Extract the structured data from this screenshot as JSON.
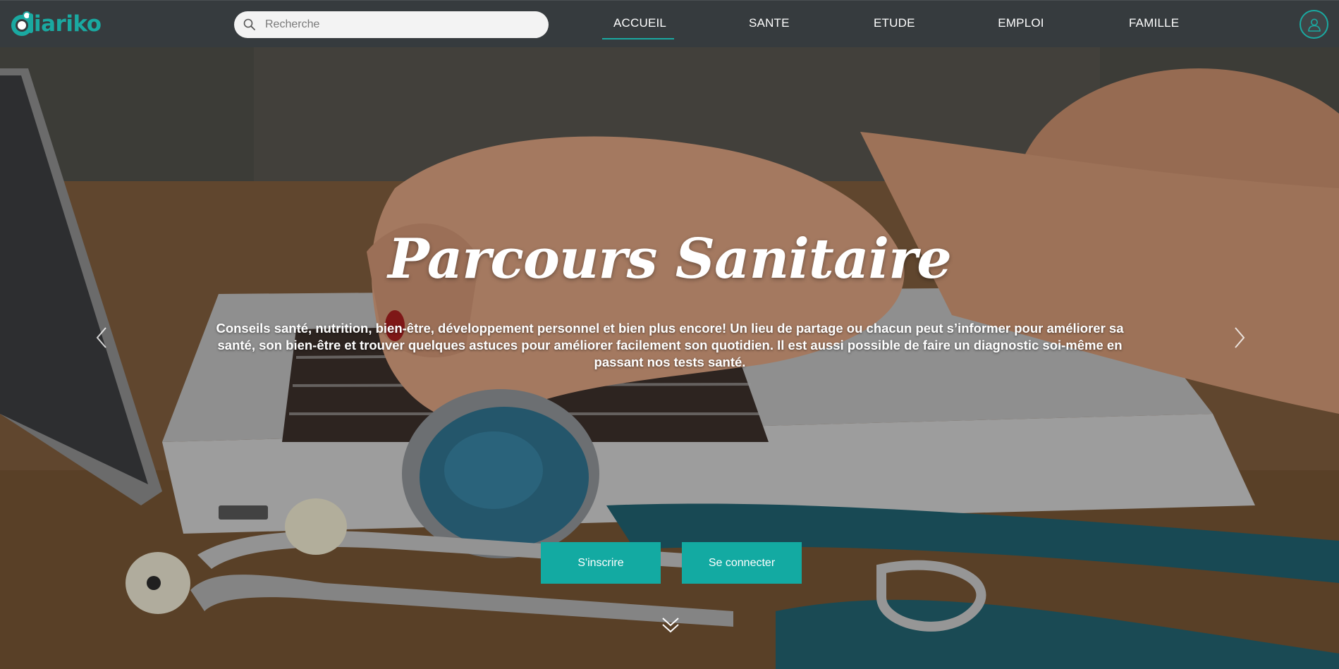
{
  "brand": {
    "logo_text": "iariko",
    "accent_color": "#1aa9a1"
  },
  "search": {
    "placeholder": "Recherche",
    "icon": "search-icon"
  },
  "nav": {
    "items": [
      {
        "label": "ACCUEIL",
        "active": true
      },
      {
        "label": "SANTE",
        "active": false
      },
      {
        "label": "ETUDE",
        "active": false
      },
      {
        "label": "EMPLOI",
        "active": false
      },
      {
        "label": "FAMILLE",
        "active": false
      }
    ],
    "user_icon": "user-icon"
  },
  "hero": {
    "title": "Parcours Sanitaire",
    "description": "Conseils santé, nutrition, bien-être, développement personnel et bien plus encore! Un lieu de partage ou chacun peut s’informer pour améliorer sa santé, son bien-être et trouver quelques astuces pour améliorer facilement son quotidien. Il est aussi possible de faire un diagnostic soi-même en passant nos tests santé.",
    "prev_icon": "chevron-left-icon",
    "next_icon": "chevron-right-icon",
    "scroll_icon": "double-chevron-down-icon"
  },
  "actions": {
    "signup_label": "S'inscrire",
    "login_label": "Se connecter",
    "button_color": "#13aaa2"
  }
}
